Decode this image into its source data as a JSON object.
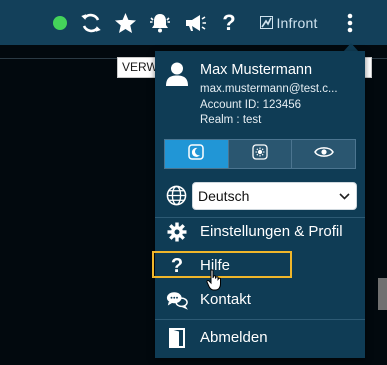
{
  "toolbar": {
    "status": "online",
    "help_label": "?",
    "brand_label": "Infront",
    "brand_color": "#cfe2ee"
  },
  "background": {
    "tag_label": "VERW",
    "tag_right_label": "-"
  },
  "user_menu": {
    "name": "Max Mustermann",
    "email": "max.mustermann@test.c...",
    "account_id": "Account ID: 123456",
    "realm": "Realm : test",
    "theme_modes": [
      "dark-mode",
      "light-mode",
      "eye-mode"
    ],
    "active_theme": "dark-mode",
    "language": {
      "selected": "Deutsch"
    },
    "items": [
      {
        "label": "Einstellungen & Profil",
        "icon": "gear-icon"
      },
      {
        "label": "Hilfe",
        "icon": "question-icon",
        "hovered": true
      },
      {
        "label": "Kontakt",
        "icon": "chat-icon"
      },
      {
        "label": "Abmelden",
        "icon": "logout-icon"
      }
    ]
  },
  "colors": {
    "topbar": "#13405a",
    "menu": "#0f3c55",
    "accent": "#2196d6",
    "highlight": "#f0b62a",
    "status_green": "#44d35a"
  }
}
